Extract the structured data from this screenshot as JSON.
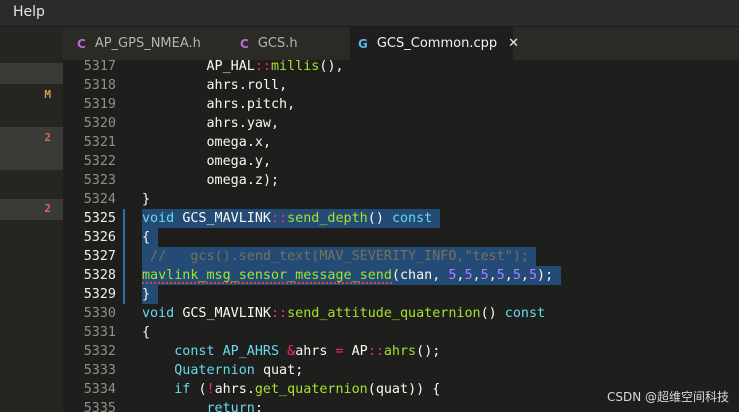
{
  "menubar": {
    "items": [
      "Help"
    ]
  },
  "tabs": [
    {
      "label": "AP_GPS_NMEA.h",
      "icon": "C",
      "active": false
    },
    {
      "label": "GCS.h",
      "icon": "C",
      "active": false
    },
    {
      "label": "GCS_Common.cpp",
      "icon": "G",
      "active": true,
      "close": "✕"
    }
  ],
  "sidebar": {
    "badges": [
      {
        "text": "M",
        "color": "#c9a15a"
      },
      {
        "text": "2",
        "color": "#d9655d"
      },
      {
        "text": "2",
        "color": "#d9655d"
      }
    ]
  },
  "editor": {
    "lines": [
      {
        "num": "5317",
        "text": "        AP_HAL::millis(),",
        "selected": false
      },
      {
        "num": "5318",
        "text": "        ahrs.roll,",
        "selected": false
      },
      {
        "num": "5319",
        "text": "        ahrs.pitch,",
        "selected": false
      },
      {
        "num": "5320",
        "text": "        ahrs.yaw,",
        "selected": false
      },
      {
        "num": "5321",
        "text": "        omega.x,",
        "selected": false
      },
      {
        "num": "5322",
        "text": "        omega.y,",
        "selected": false
      },
      {
        "num": "5323",
        "text": "        omega.z);",
        "selected": false
      },
      {
        "num": "5324",
        "text": "}",
        "selected": false
      },
      {
        "num": "5325",
        "text": "void GCS_MAVLINK::send_depth() const",
        "selected": true
      },
      {
        "num": "5326",
        "text": "{",
        "selected": true
      },
      {
        "num": "5327",
        "text": " //   gcs().send_text(MAV_SEVERITY_INFO,\"test\");",
        "selected": true
      },
      {
        "num": "5328",
        "text": "mavlink_msg_sensor_message_send(chan, 5,5,5,5,5,5);",
        "selected": true
      },
      {
        "num": "5329",
        "text": "}",
        "selected": true
      },
      {
        "num": "5330",
        "text": "void GCS_MAVLINK::send_attitude_quaternion() const",
        "selected": false
      },
      {
        "num": "5331",
        "text": "{",
        "selected": false
      },
      {
        "num": "5332",
        "text": "    const AP_AHRS &ahrs = AP::ahrs();",
        "selected": false
      },
      {
        "num": "5333",
        "text": "    Quaternion quat;",
        "selected": false
      },
      {
        "num": "5334",
        "text": "    if (!ahrs.get_quaternion(quat)) {",
        "selected": false
      },
      {
        "num": "5335",
        "text": "        return;",
        "selected": false
      }
    ]
  },
  "watermark": "CSDN @超维空间科技",
  "colors": {
    "keyword": "#66d9ef",
    "type": "#66d9ef",
    "function": "#a6e22e",
    "string": "#e6db74",
    "number": "#ae81ff",
    "operator": "#f92672",
    "comment": "#75715e",
    "selection": "#244a76"
  }
}
